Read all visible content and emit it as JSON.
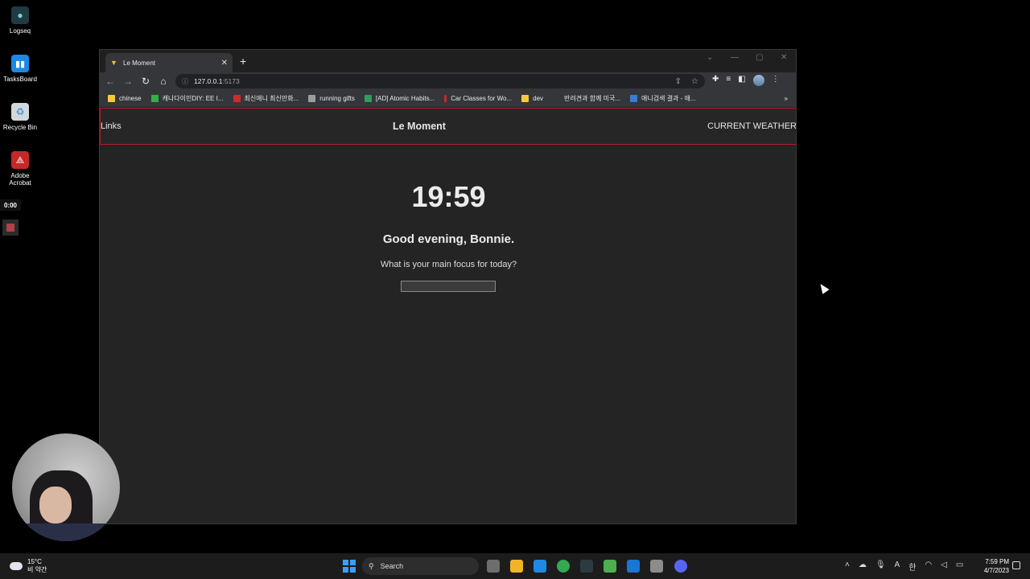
{
  "desktop": {
    "icons": [
      {
        "label": "Logseq"
      },
      {
        "label": "TasksBoard"
      },
      {
        "label": "Recycle Bin"
      },
      {
        "label": "Adobe Acrobat"
      }
    ],
    "recorder_time": "0:00"
  },
  "browser": {
    "tab_title": "Le Moment",
    "url_host": "127.0.0.1",
    "url_port": ":5173",
    "bookmarks": [
      {
        "label": "chinese",
        "color": "#f5c842"
      },
      {
        "label": "캐나다이민DIY: EE I...",
        "color": "#2fb14a"
      },
      {
        "label": "최신애니 최신만화...",
        "color": "#d02b2b"
      },
      {
        "label": "running gifts",
        "color": "#9c9c9c"
      },
      {
        "label": "[AD] Atomic Habits...",
        "color": "#2e9e5a"
      },
      {
        "label": "Car Classes for Wo...",
        "color": "#c62828"
      },
      {
        "label": "dev",
        "color": "#f5c842"
      },
      {
        "label": "반려견과 함께 미국...",
        "color": "#35363a"
      },
      {
        "label": "애니검색 결과 - 애...",
        "color": "#3a7bd5"
      }
    ],
    "bookmarks_more": "»"
  },
  "app": {
    "nav_links": "Links",
    "brand": "Le Moment",
    "nav_weather": "CURRENT WEATHER",
    "time": "19:59",
    "greeting": "Good evening, Bonnie.",
    "question": "What is your main focus for today?",
    "focus_value": ""
  },
  "taskbar": {
    "weather_temp": "15°C",
    "weather_desc": "비 약간",
    "search_label": "Search",
    "lang": "한",
    "time": "7:59 PM",
    "date": "4/7/2023"
  },
  "colors": {
    "page_bg": "#242424",
    "navbar_border": "#b3202a",
    "accent_blue": "#3aa0ff"
  }
}
